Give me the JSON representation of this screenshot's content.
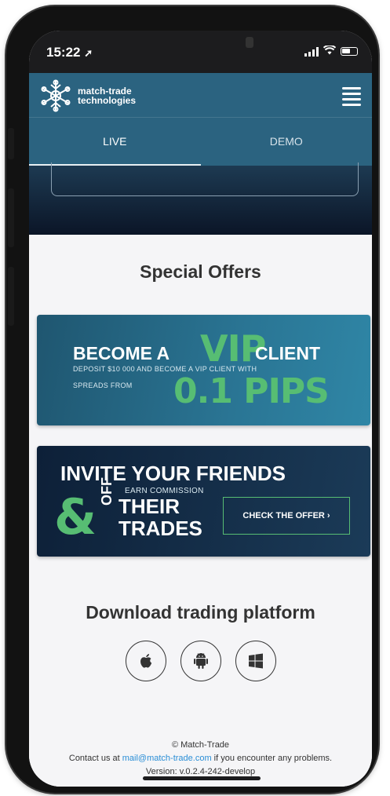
{
  "status_bar": {
    "time": "15:22",
    "time_arrow": "➚",
    "signal": "signal-bars-icon",
    "wifi": "wifi-icon",
    "battery": "battery-icon"
  },
  "header": {
    "brand_line1": "match-trade",
    "brand_line2": "technologies",
    "menu": "hamburger-menu-icon"
  },
  "tabs": [
    {
      "label": "LIVE",
      "active": true
    },
    {
      "label": "DEMO",
      "active": false
    }
  ],
  "special_offers": {
    "title": "Special Offers",
    "vip_banner": {
      "become_a": "BECOME A",
      "vip": "VIP",
      "client": "CLIENT",
      "deposit_line": "DEPOSIT $10 000 AND BECOME A VIP CLIENT WITH",
      "spreads_from": "SPREADS FROM",
      "pips": "0.1 PIPS"
    },
    "invite_banner": {
      "headline": "INVITE YOUR FRIENDS",
      "ampersand": "&",
      "earn": "EARN COMMISSION",
      "off": "OFF",
      "their": "THEIR",
      "trades": "TRADES",
      "cta": "CHECK THE OFFER ›"
    }
  },
  "download": {
    "title": "Download trading platform",
    "platforms": [
      "apple-icon",
      "android-icon",
      "windows-icon"
    ]
  },
  "footer": {
    "copyright": "© Match-Trade",
    "contact_prefix": "Contact us at ",
    "email": "mail@match-trade.com",
    "contact_suffix": " if you encounter any problems.",
    "version": "Version: v.0.2.4-242-develop"
  },
  "colors": {
    "header_bg": "#2b6380",
    "accent_green": "#57bd73",
    "link_blue": "#2a8ed6"
  }
}
